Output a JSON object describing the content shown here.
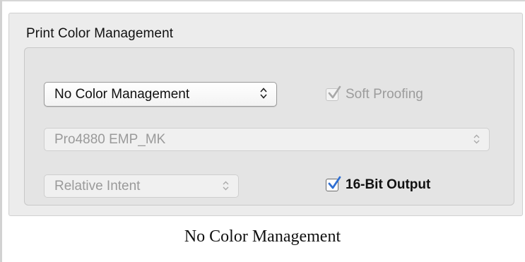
{
  "group": {
    "title": "Print Color Management"
  },
  "color_handling": {
    "selected": "No Color Management",
    "arrows": "↕"
  },
  "soft_proofing": {
    "label": "Soft Proofing",
    "checked": true,
    "enabled": false
  },
  "printer_profile": {
    "selected": "Pro4880 EMP_MK",
    "arrows": "↕",
    "enabled": false
  },
  "rendering_intent": {
    "selected": "Relative Intent",
    "arrows": "↕",
    "enabled": false
  },
  "bit_output": {
    "label": "16-Bit Output",
    "checked": true,
    "enabled": true
  },
  "caption": {
    "text": "No Color Management"
  },
  "colors": {
    "panel_bg": "#ececec",
    "group_bg": "#e4e4e4",
    "disabled_text": "#9a9a9a",
    "check_blue": "#2f6fd3"
  },
  "icons": {
    "popup_arrows": "updown-arrows-icon",
    "checkmark": "checkmark-icon"
  }
}
